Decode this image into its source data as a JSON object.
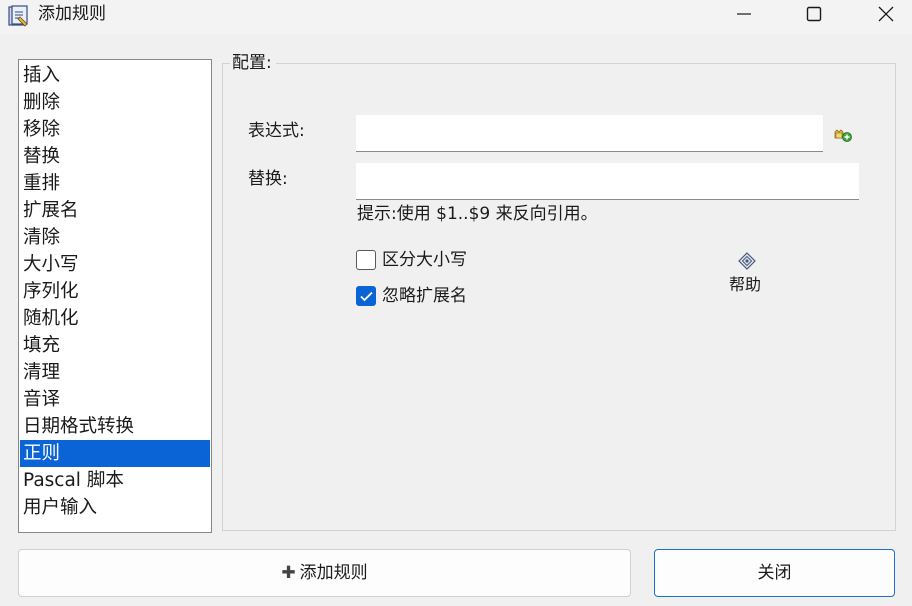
{
  "window": {
    "title": "添加规则",
    "icon": "app-notebook-icon",
    "controls": [
      "minimize-icon",
      "maximize-icon",
      "close-icon"
    ]
  },
  "rules": {
    "items": [
      {
        "label": "插入",
        "selected": false
      },
      {
        "label": "删除",
        "selected": false
      },
      {
        "label": "移除",
        "selected": false
      },
      {
        "label": "替换",
        "selected": false
      },
      {
        "label": "重排",
        "selected": false
      },
      {
        "label": "扩展名",
        "selected": false
      },
      {
        "label": "清除",
        "selected": false
      },
      {
        "label": "大小写",
        "selected": false
      },
      {
        "label": "序列化",
        "selected": false
      },
      {
        "label": "随机化",
        "selected": false
      },
      {
        "label": "填充",
        "selected": false
      },
      {
        "label": "清理",
        "selected": false
      },
      {
        "label": "音译",
        "selected": false
      },
      {
        "label": "日期格式转换",
        "selected": false
      },
      {
        "label": "正则",
        "selected": true
      },
      {
        "label": "Pascal 脚本",
        "selected": false
      },
      {
        "label": "用户输入",
        "selected": false
      }
    ],
    "selected_color": "#0a64d6"
  },
  "config": {
    "legend": "配置:",
    "expression_label": "表达式:",
    "expression_value": "",
    "replace_label": "替换:",
    "replace_value": "",
    "hint": "提示:使用 $1..$9 来反向引用。",
    "case_sensitive": {
      "label": "区分大小写",
      "checked": false
    },
    "ignore_extension": {
      "label": "忽略扩展名",
      "checked": true
    },
    "help_label": "帮助"
  },
  "buttons": {
    "add_rule": "添加规则",
    "close": "关闭"
  },
  "colors": {
    "accent": "#0a64d6",
    "background": "#f0f0f0"
  }
}
